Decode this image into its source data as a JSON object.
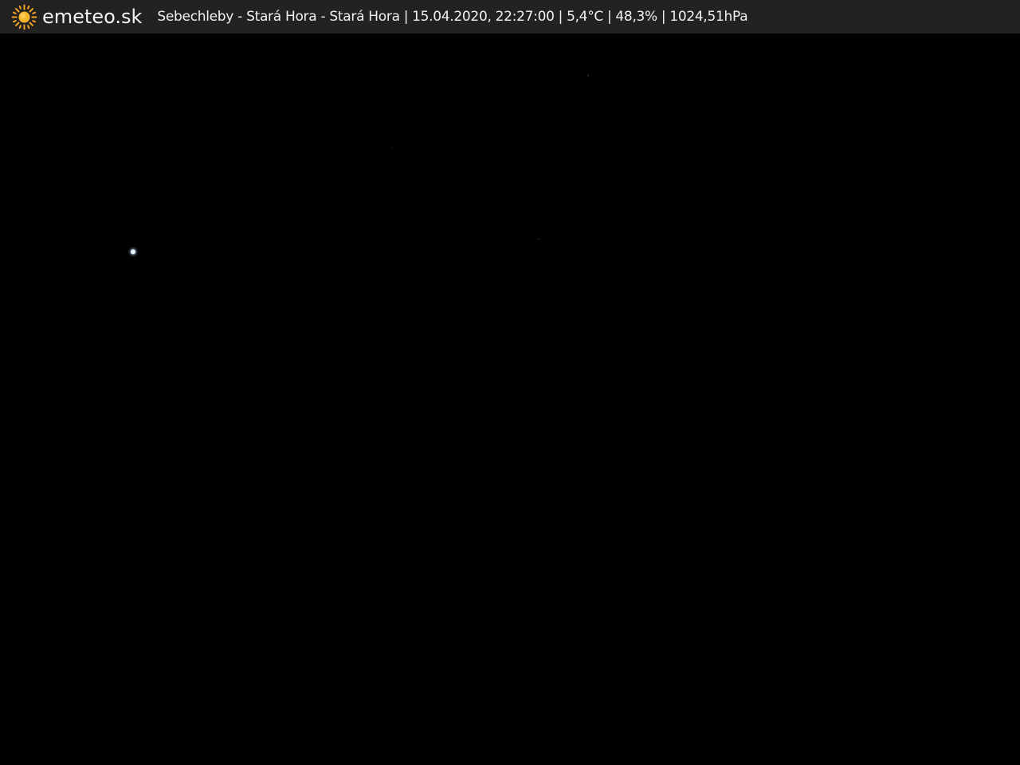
{
  "header": {
    "brand": "emeteo.sk",
    "logo_icon": "sun-icon",
    "station": "Sebechleby - Stará Hora - Stará Hora",
    "datetime": "15.04.2020, 22:27:00",
    "temperature": "5,4°C",
    "humidity": "48,3%",
    "pressure": "1024,51hPa",
    "separator": "|"
  },
  "colors": {
    "bar_background": "#222222",
    "text": "#f2f2f2",
    "sun": "#f5a623",
    "scene": "#000000",
    "star": "#e8f2ff"
  }
}
